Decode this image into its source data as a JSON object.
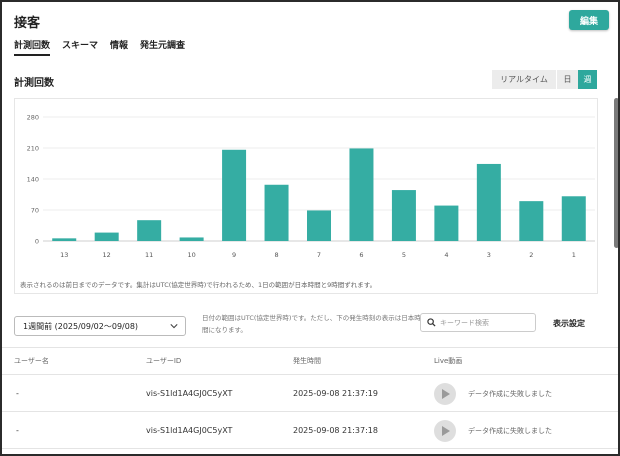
{
  "header": {
    "title": "接客",
    "edit_label": "編集"
  },
  "tabs": [
    {
      "label": "計測回数",
      "active": true
    },
    {
      "label": "スキーマ",
      "active": false
    },
    {
      "label": "情報",
      "active": false
    },
    {
      "label": "発生元調査",
      "active": false
    }
  ],
  "section": {
    "title": "計測回数"
  },
  "range_toggle": {
    "realtime": "リアルタイム",
    "day": "日",
    "week": "週",
    "selected": "週"
  },
  "colors": {
    "accent": "#2ea89d",
    "bar": "#35ada3"
  },
  "chart_data": {
    "type": "bar",
    "categories": [
      "13",
      "12",
      "11",
      "10",
      "9",
      "8",
      "7",
      "6",
      "5",
      "4",
      "3",
      "2",
      "1"
    ],
    "values": [
      6,
      19,
      47,
      8,
      206,
      127,
      69,
      209,
      115,
      80,
      174,
      90,
      101
    ],
    "yticks": [
      0,
      70,
      140,
      210,
      280
    ],
    "ylim": [
      0,
      280
    ],
    "title": "",
    "xlabel": "",
    "ylabel": "",
    "grid": true
  },
  "chart_note": "表示されるのは前日までのデータです。集計はUTC(協定世界時)で行われるため、1日の範囲が日本時間と9時間ずれます。",
  "filter": {
    "period_value": "1週間前 (2025/09/02〜09/08)",
    "range_note": "日付の範囲はUTC(協定世界時)です。ただし、下の発生時刻の表示は日本時間になります。",
    "search_placeholder": "キーワード検索",
    "display_settings": "表示設定"
  },
  "table": {
    "headers": {
      "user_name": "ユーザー名",
      "user_id": "ユーザーID",
      "time": "発生時間",
      "live": "Live動画"
    },
    "rows": [
      {
        "user_name": "-",
        "user_id": "vis-S1ld1A4GJ0C5yXT",
        "time": "2025-09-08 21:37:19",
        "status": "データ作成に失敗しました"
      },
      {
        "user_name": "-",
        "user_id": "vis-S1ld1A4GJ0C5yXT",
        "time": "2025-09-08 21:37:18",
        "status": "データ作成に失敗しました"
      }
    ]
  }
}
